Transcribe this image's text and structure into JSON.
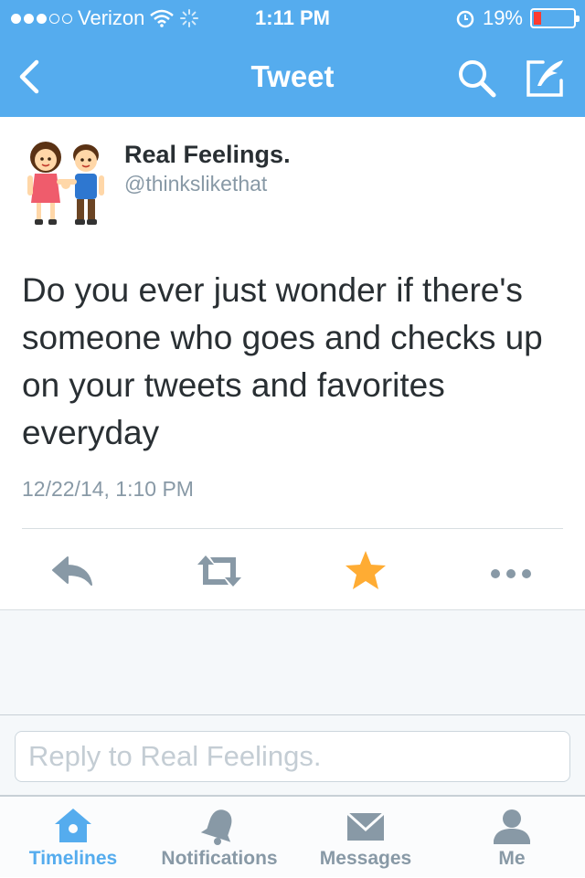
{
  "status_bar": {
    "carrier": "Verizon",
    "time": "1:11 PM",
    "battery": "19%",
    "battery_level": 0.19,
    "signal_dots_filled": 3,
    "signal_dots_total": 5
  },
  "nav": {
    "title": "Tweet",
    "icons": [
      "back-chevron-icon",
      "search-icon",
      "compose-icon"
    ]
  },
  "tweet": {
    "author_name": "Real Feelings.",
    "author_handle": "@thinkslikethat",
    "avatar": "couple-holding-hands-icon",
    "text": "Do you ever just wonder if there's someone who goes and checks up on your tweets and favorites everyday",
    "timestamp": "12/22/14, 1:10 PM",
    "favorited": true
  },
  "actions": [
    "reply-icon",
    "retweet-icon",
    "favorite-star-icon",
    "more-icon"
  ],
  "reply": {
    "placeholder": "Reply to Real Feelings."
  },
  "tabs": [
    {
      "label": "Timelines",
      "icon": "home-icon",
      "active": true
    },
    {
      "label": "Notifications",
      "icon": "bell-icon",
      "active": false
    },
    {
      "label": "Messages",
      "icon": "envelope-icon",
      "active": false
    },
    {
      "label": "Me",
      "icon": "person-icon",
      "active": false
    }
  ],
  "colors": {
    "brand": "#55acee",
    "text": "#292f33",
    "secondary": "#8899a6",
    "favorite": "#ffac33",
    "battery_low": "#ff3b30"
  }
}
